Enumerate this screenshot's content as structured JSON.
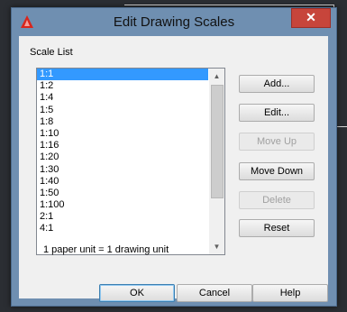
{
  "window": {
    "title": "Edit Drawing Scales",
    "close_glyph": "✕"
  },
  "scale_list": {
    "label": "Scale List",
    "items": [
      "1:1",
      "1:2",
      "1:4",
      "1:5",
      "1:8",
      "1:10",
      "1:16",
      "1:20",
      "1:30",
      "1:40",
      "1:50",
      "1:100",
      "2:1",
      "4:1"
    ],
    "selected_index": 0
  },
  "side_buttons": {
    "add": "Add...",
    "edit": "Edit...",
    "move_up": "Move Up",
    "move_down": "Move Down",
    "delete": "Delete",
    "reset": "Reset"
  },
  "status_text": "1 paper unit = 1 drawing unit",
  "footer_buttons": {
    "ok": "OK",
    "cancel": "Cancel",
    "help": "Help"
  },
  "colors": {
    "selection": "#3399ff",
    "close_button": "#c7453b",
    "frame": "#6f8fb1"
  }
}
